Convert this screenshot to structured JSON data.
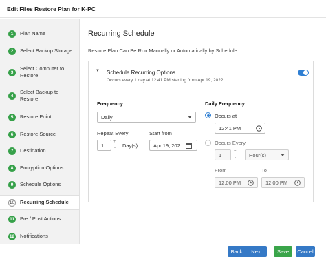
{
  "window": {
    "title": "Edit Files Restore Plan for K-PC"
  },
  "sidebar": {
    "steps": [
      {
        "num": "1",
        "label": "Plan Name"
      },
      {
        "num": "2",
        "label": "Select Backup Storage"
      },
      {
        "num": "3",
        "label": "Select Computer to Restore"
      },
      {
        "num": "4",
        "label": "Select Backup to Restore"
      },
      {
        "num": "5",
        "label": "Restore Point"
      },
      {
        "num": "6",
        "label": "Restore Source"
      },
      {
        "num": "7",
        "label": "Destination"
      },
      {
        "num": "8",
        "label": "Encryption Options"
      },
      {
        "num": "9",
        "label": "Schedule Options"
      },
      {
        "num": "10",
        "label": "Recurring Schedule"
      },
      {
        "num": "11",
        "label": "Pre / Post Actions"
      },
      {
        "num": "12",
        "label": "Notifications"
      }
    ],
    "active_step": "10"
  },
  "main": {
    "title": "Recurring Schedule",
    "description": "Restore Plan Can Be Run Manually or Automatically by Schedule"
  },
  "panel": {
    "title": "Schedule Recurring Options",
    "summary": "Occurs every 1 day at 12:41 PM starting from Apr 19, 2022",
    "enabled": true
  },
  "frequency": {
    "label": "Frequency",
    "selected": "Daily",
    "repeat_label": "Repeat Every",
    "repeat_value": "1",
    "repeat_unit": "Day(s)",
    "start_label": "Start from",
    "start_value": "Apr 19, 202"
  },
  "daily_frequency": {
    "label": "Daily Frequency",
    "occurs_at_label": "Occurs at",
    "occurs_at_value": "12:41 PM",
    "occurs_every_label": "Occurs Every",
    "every_value": "1",
    "every_unit": "Hour(s)",
    "from_label": "From",
    "from_value": "12:00 PM",
    "to_label": "To",
    "to_value": "12:00 PM",
    "mode": "occurs_at"
  },
  "footer": {
    "back": "Back",
    "next": "Next",
    "save": "Save",
    "cancel": "Cancel"
  },
  "colors": {
    "step_done": "#37a14a",
    "primary": "#3579c6",
    "save": "#3aa54a",
    "toggle_on": "#2f7fd3"
  }
}
